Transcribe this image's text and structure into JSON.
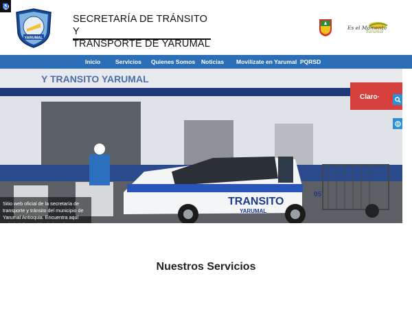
{
  "header": {
    "title_line1": "SECRETARÍA DE TRÁNSITO Y",
    "title_line2": "TRANSPORTE DE YARUMAL",
    "logo_text": "YARUMAL",
    "brand_main": "Es el Momento",
    "brand_sub": "Yarumal"
  },
  "nav": {
    "items": [
      "Inicio",
      "Servicios",
      "Quienes Somos",
      "Noticias",
      "Movilizate en Yarumal",
      "PQRSD"
    ]
  },
  "hero": {
    "caption": "Sitio web oficial de la secretaría de transporte y tránsito del municipio de Yarumal Antioquia. Encuentra aquí toda la información de interés acerca de esta dependencia.",
    "sign_text": "Y TRANSITO YARUMAL",
    "store_sign": "Claro·",
    "truck_text": "TRANSITO",
    "truck_sub": "YARUMAL",
    "truck_number": "05"
  },
  "services": {
    "title": "Nuestros Servicios"
  },
  "icons": {
    "accessibility": "accessibility-icon",
    "search": "search-icon",
    "globe": "globe-icon"
  },
  "colors": {
    "nav": "#2d6fb7",
    "side_buttons": "#2d8fd6"
  }
}
